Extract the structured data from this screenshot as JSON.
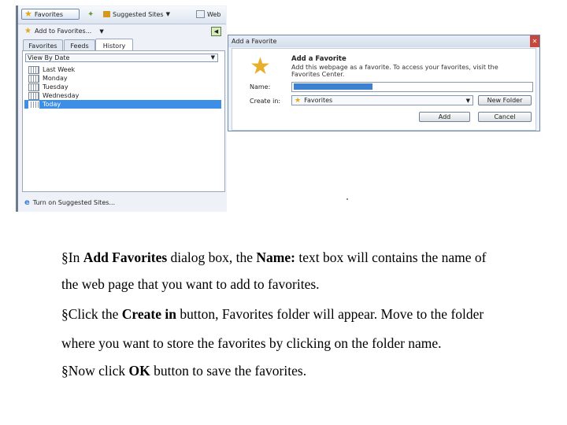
{
  "favorites_pane": {
    "toolbar": {
      "favorites_label": "Favorites",
      "suggested_sites_label": "Suggested Sites",
      "web_slice_label": "Web"
    },
    "add_to_favorites_label": "Add to Favorites...",
    "tabs": [
      {
        "label": "Favorites",
        "active": false
      },
      {
        "label": "Feeds",
        "active": false
      },
      {
        "label": "History",
        "active": true
      }
    ],
    "view_by": "View By Date",
    "history_items": [
      {
        "label": "Last Week",
        "selected": false
      },
      {
        "label": "Monday",
        "selected": false
      },
      {
        "label": "Tuesday",
        "selected": false
      },
      {
        "label": "Wednesday",
        "selected": false
      },
      {
        "label": "Today",
        "selected": true
      }
    ],
    "bottom_link": "Turn on Suggested Sites..."
  },
  "dialog": {
    "title": "Add a Favorite",
    "heading": "Add a Favorite",
    "description_line1": "Add this webpage as a favorite. To access your favorites, visit the",
    "description_line2": "Favorites Center.",
    "name_label": "Name:",
    "create_in_label": "Create in:",
    "create_in_value": "Favorites",
    "new_folder_label": "New Folder",
    "add_label": "Add",
    "cancel_label": "Cancel"
  },
  "instructions": {
    "p1": {
      "pre": "§In ",
      "b1": "Add Favorites",
      "mid": " dialog box, the ",
      "b2": "Name:",
      "post": " text box will contains the name of"
    },
    "p1_cont": "the web page that you want to add to favorites.",
    "p2": {
      "pre": "§Click the ",
      "b1": "Create in",
      "post": " button, Favorites folder will appear. Move to the folder"
    },
    "p2_cont": "where you want to store the favorites by clicking on the folder name.",
    "p3": {
      "pre": "§Now click ",
      "b1": "OK",
      "post": " button to save the favorites."
    }
  },
  "colors": {
    "selection": "#3d8ee6",
    "star": "#e3a81a",
    "dialog_border": "#6d87ab"
  }
}
